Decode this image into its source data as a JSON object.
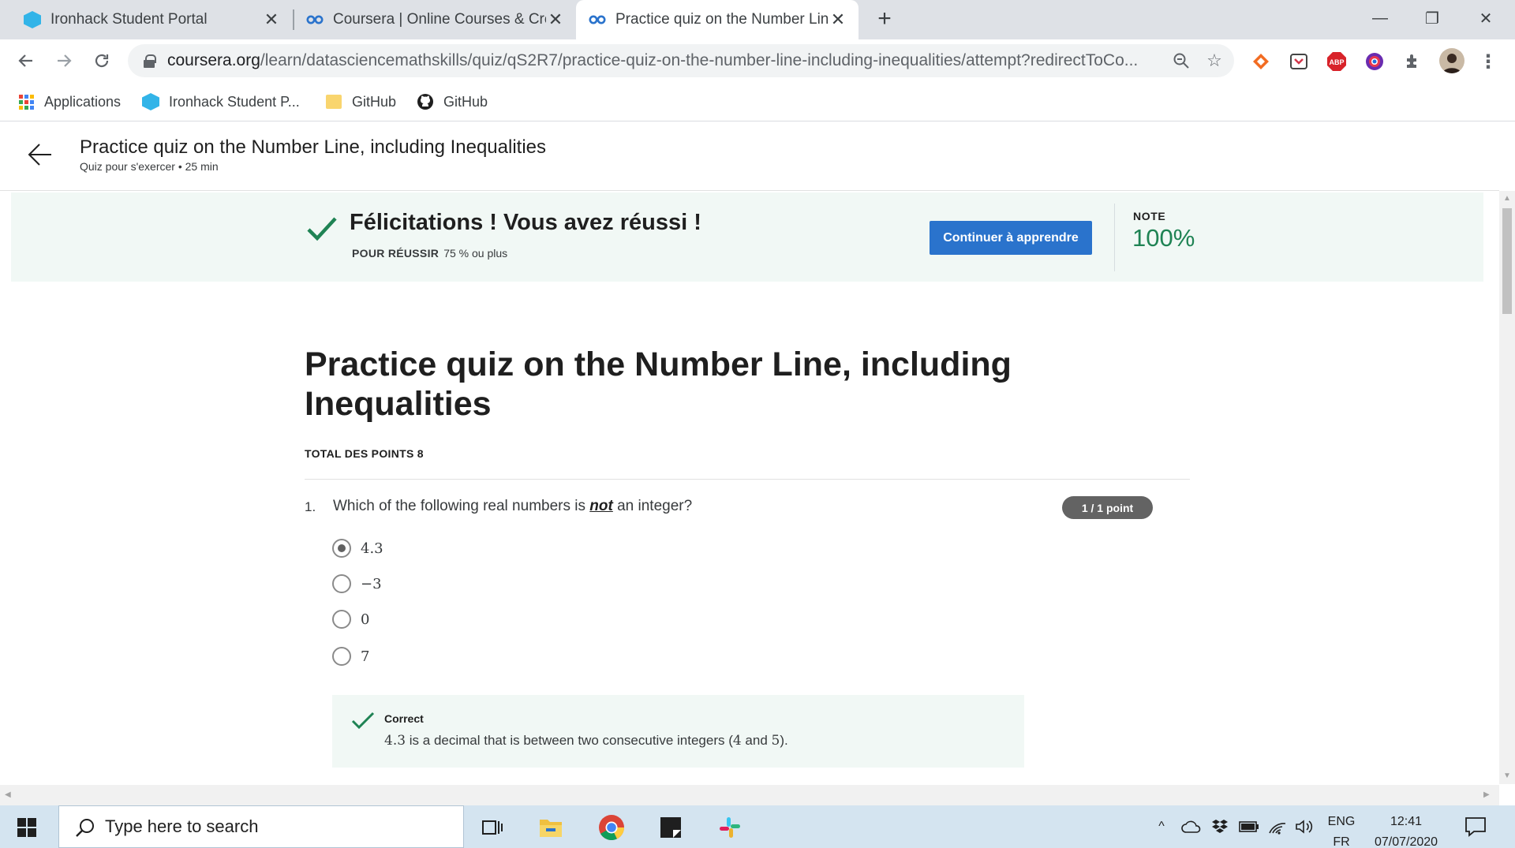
{
  "browser": {
    "tabs": [
      {
        "title": "Ironhack Student Portal",
        "favicon": "ironhack-icon",
        "active": false
      },
      {
        "title": "Coursera | Online Courses & Credentials",
        "favicon": "coursera-icon",
        "active": false
      },
      {
        "title": "Practice quiz on the Number Line, including Inequalities",
        "favicon": "coursera-icon",
        "active": true
      }
    ],
    "new_tab": "+",
    "url_host": "coursera.org",
    "url_path": "/learn/datasciencemathskills/quiz/qS2R7/practice-quiz-on-the-number-line-including-inequalities/attempt?redirectToCo...",
    "bookmarks": [
      {
        "label": "Applications",
        "icon": "apps-grid-icon"
      },
      {
        "label": "Ironhack Student P...",
        "icon": "ironhack-icon"
      },
      {
        "label": "GitHub",
        "icon": "folder-icon"
      },
      {
        "label": "GitHub",
        "icon": "github-icon"
      }
    ],
    "extensions": [
      "honey-icon",
      "pocket-icon",
      "adblock-plus-icon",
      "color-picker-icon",
      "extensions-icon",
      "profile-avatar"
    ],
    "abp_label": "ABP"
  },
  "header": {
    "title": "Practice quiz on the Number Line, including Inequalities",
    "subtitle": "Quiz pour s'exercer • 25  min"
  },
  "banner": {
    "title": "Félicitations ! Vous avez réussi !",
    "pass_label": "POUR RÉUSSIR",
    "pass_value": "75 % ou plus",
    "continue_button": "Continuer à apprendre",
    "note_label": "NOTE",
    "note_value": "100%"
  },
  "quiz": {
    "title": "Practice quiz on the Number Line, including Inequalities",
    "total_points": "TOTAL DES POINTS 8",
    "question": {
      "number": "1.",
      "text_before": "Which of the following real numbers is ",
      "emphasis": "not",
      "text_after": " an integer?",
      "points": "1 / 1 point",
      "options": [
        {
          "label": "4.3",
          "selected": true
        },
        {
          "label": "−3",
          "selected": false
        },
        {
          "label": "0",
          "selected": false
        },
        {
          "label": "7",
          "selected": false
        }
      ],
      "feedback_title": "Correct",
      "feedback_math": "4.3",
      "feedback_text": " is a decimal that is between two consecutive integers (",
      "feedback_math2": "4",
      "feedback_text2": " and ",
      "feedback_math3": "5",
      "feedback_text3": ")."
    }
  },
  "taskbar": {
    "search_placeholder": "Type here to search",
    "lang_top": "ENG",
    "lang_bottom": "FR",
    "time": "12:41",
    "date": "07/07/2020"
  },
  "colors": {
    "accent": "#2a73cc",
    "success": "#1f8354",
    "banner_bg": "#f1f8f5"
  }
}
